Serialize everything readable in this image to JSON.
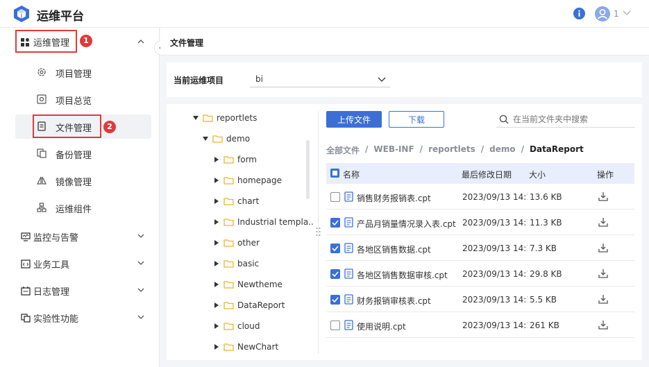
{
  "colors": {
    "accent": "#3b6fd6",
    "red_marker": "#e03a3a",
    "folder": "#f0b429",
    "active_bg": "#f0f2f5"
  },
  "header": {
    "title": "运维平台",
    "user_label": "1"
  },
  "sidebar": {
    "group_ops": {
      "label": "运维管理",
      "badge": "1"
    },
    "ops_items": [
      {
        "label": "项目管理",
        "icon": "gear-icon"
      },
      {
        "label": "项目总览",
        "icon": "overview-icon"
      },
      {
        "label": "文件管理",
        "icon": "file-doc-icon"
      },
      {
        "label": "备份管理",
        "icon": "backup-icon"
      },
      {
        "label": "镜像管理",
        "icon": "mirror-icon"
      },
      {
        "label": "运维组件",
        "icon": "components-icon"
      }
    ],
    "file_badge": "2",
    "groups": [
      {
        "label": "监控与告警",
        "icon": "monitor-icon"
      },
      {
        "label": "业务工具",
        "icon": "code-tools-icon"
      },
      {
        "label": "日志管理",
        "icon": "calendar-log-icon"
      },
      {
        "label": "实验性功能",
        "icon": "experiment-icon"
      }
    ]
  },
  "main": {
    "page_title": "文件管理",
    "project_label": "当前运维项目",
    "project_value": "bi",
    "tree": [
      {
        "label": "reportlets",
        "level": 0,
        "expanded": true
      },
      {
        "label": "demo",
        "level": 1,
        "expanded": true
      },
      {
        "label": "form",
        "level": 2
      },
      {
        "label": "homepage",
        "level": 2
      },
      {
        "label": "chart",
        "level": 2
      },
      {
        "label": "Industrial templa...",
        "level": 2
      },
      {
        "label": "other",
        "level": 2
      },
      {
        "label": "basic",
        "level": 2
      },
      {
        "label": "Newtheme",
        "level": 2
      },
      {
        "label": "DataReport",
        "level": 2
      },
      {
        "label": "cloud",
        "level": 2
      },
      {
        "label": "NewChart",
        "level": 2
      }
    ],
    "upload_label": "上传文件",
    "download_label": "下载",
    "search_placeholder": "在当前文件夹中搜索",
    "breadcrumb": [
      "全部文件",
      "WEB-INF",
      "reportlets",
      "demo",
      "DataReport"
    ],
    "breadcrumb_sep": "/",
    "columns": {
      "name": "名称",
      "modified": "最后修改日期",
      "size": "大小",
      "action": "操作"
    },
    "files": [
      {
        "name": "销售财务报销表.cpt",
        "modified": "2023/09/13 14:1...",
        "size": "13.6 KB",
        "checked": false
      },
      {
        "name": "产品月销量情况录入表.cpt",
        "modified": "2023/09/13 14:1...",
        "size": "11.3 KB",
        "checked": true
      },
      {
        "name": "各地区销售数据.cpt",
        "modified": "2023/09/13 14:1...",
        "size": "7.3 KB",
        "checked": true
      },
      {
        "name": "各地区销售数据审核.cpt",
        "modified": "2023/09/13 14:1...",
        "size": "29.8 KB",
        "checked": true
      },
      {
        "name": "财务报销审核表.cpt",
        "modified": "2023/09/13 14:1...",
        "size": "5.5 KB",
        "checked": true
      },
      {
        "name": "使用说明.cpt",
        "modified": "2023/09/13 14:1...",
        "size": "261 KB",
        "checked": false
      }
    ]
  }
}
